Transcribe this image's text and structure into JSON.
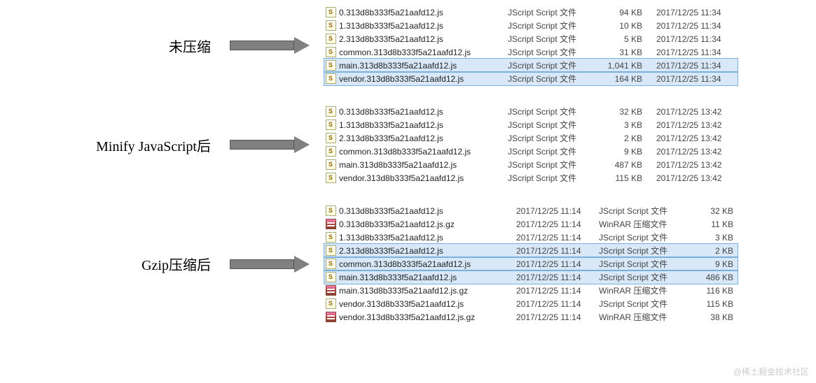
{
  "watermark": "@稀土掘金技术社区",
  "sections": [
    {
      "label": "未压缩",
      "layout": "A",
      "rows": [
        {
          "icon": "js",
          "name": "0.313d8b333f5a21aafd12.js",
          "type": "JScript Script 文件",
          "size": "94 KB",
          "date": "2017/12/25 11:34",
          "selected": false
        },
        {
          "icon": "js",
          "name": "1.313d8b333f5a21aafd12.js",
          "type": "JScript Script 文件",
          "size": "10 KB",
          "date": "2017/12/25 11:34",
          "selected": false
        },
        {
          "icon": "js",
          "name": "2.313d8b333f5a21aafd12.js",
          "type": "JScript Script 文件",
          "size": "5 KB",
          "date": "2017/12/25 11:34",
          "selected": false
        },
        {
          "icon": "js",
          "name": "common.313d8b333f5a21aafd12.js",
          "type": "JScript Script 文件",
          "size": "31 KB",
          "date": "2017/12/25 11:34",
          "selected": false
        },
        {
          "icon": "js",
          "name": "main.313d8b333f5a21aafd12.js",
          "type": "JScript Script 文件",
          "size": "1,041 KB",
          "date": "2017/12/25 11:34",
          "selected": true
        },
        {
          "icon": "js",
          "name": "vendor.313d8b333f5a21aafd12.js",
          "type": "JScript Script 文件",
          "size": "164 KB",
          "date": "2017/12/25 11:34",
          "selected": true
        }
      ]
    },
    {
      "label": "Minify JavaScript后",
      "layout": "A",
      "rows": [
        {
          "icon": "js",
          "name": "0.313d8b333f5a21aafd12.js",
          "type": "JScript Script 文件",
          "size": "32 KB",
          "date": "2017/12/25 13:42",
          "selected": false
        },
        {
          "icon": "js",
          "name": "1.313d8b333f5a21aafd12.js",
          "type": "JScript Script 文件",
          "size": "3 KB",
          "date": "2017/12/25 13:42",
          "selected": false
        },
        {
          "icon": "js",
          "name": "2.313d8b333f5a21aafd12.js",
          "type": "JScript Script 文件",
          "size": "2 KB",
          "date": "2017/12/25 13:42",
          "selected": false
        },
        {
          "icon": "js",
          "name": "common.313d8b333f5a21aafd12.js",
          "type": "JScript Script 文件",
          "size": "9 KB",
          "date": "2017/12/25 13:42",
          "selected": false
        },
        {
          "icon": "js",
          "name": "main.313d8b333f5a21aafd12.js",
          "type": "JScript Script 文件",
          "size": "487 KB",
          "date": "2017/12/25 13:42",
          "selected": false
        },
        {
          "icon": "js",
          "name": "vendor.313d8b333f5a21aafd12.js",
          "type": "JScript Script 文件",
          "size": "115 KB",
          "date": "2017/12/25 13:42",
          "selected": false
        }
      ]
    },
    {
      "label": "Gzip压缩后",
      "layout": "B",
      "rows": [
        {
          "icon": "js",
          "name": "0.313d8b333f5a21aafd12.js",
          "date": "2017/12/25 11:14",
          "type": "JScript Script 文件",
          "size": "32 KB",
          "selected": false
        },
        {
          "icon": "gz",
          "name": "0.313d8b333f5a21aafd12.js.gz",
          "date": "2017/12/25 11:14",
          "type": "WinRAR 压缩文件",
          "size": "11 KB",
          "selected": false
        },
        {
          "icon": "js",
          "name": "1.313d8b333f5a21aafd12.js",
          "date": "2017/12/25 11:14",
          "type": "JScript Script 文件",
          "size": "3 KB",
          "selected": false
        },
        {
          "icon": "js",
          "name": "2.313d8b333f5a21aafd12.js",
          "date": "2017/12/25 11:14",
          "type": "JScript Script 文件",
          "size": "2 KB",
          "selected": true
        },
        {
          "icon": "js",
          "name": "common.313d8b333f5a21aafd12.js",
          "date": "2017/12/25 11:14",
          "type": "JScript Script 文件",
          "size": "9 KB",
          "selected": true
        },
        {
          "icon": "js",
          "name": "main.313d8b333f5a21aafd12.js",
          "date": "2017/12/25 11:14",
          "type": "JScript Script 文件",
          "size": "486 KB",
          "selected": true
        },
        {
          "icon": "gz",
          "name": "main.313d8b333f5a21aafd12.js.gz",
          "date": "2017/12/25 11:14",
          "type": "WinRAR 压缩文件",
          "size": "116 KB",
          "selected": false
        },
        {
          "icon": "js",
          "name": "vendor.313d8b333f5a21aafd12.js",
          "date": "2017/12/25 11:14",
          "type": "JScript Script 文件",
          "size": "115 KB",
          "selected": false
        },
        {
          "icon": "gz",
          "name": "vendor.313d8b333f5a21aafd12.js.gz",
          "date": "2017/12/25 11:14",
          "type": "WinRAR 压缩文件",
          "size": "38 KB",
          "selected": false
        }
      ]
    }
  ]
}
